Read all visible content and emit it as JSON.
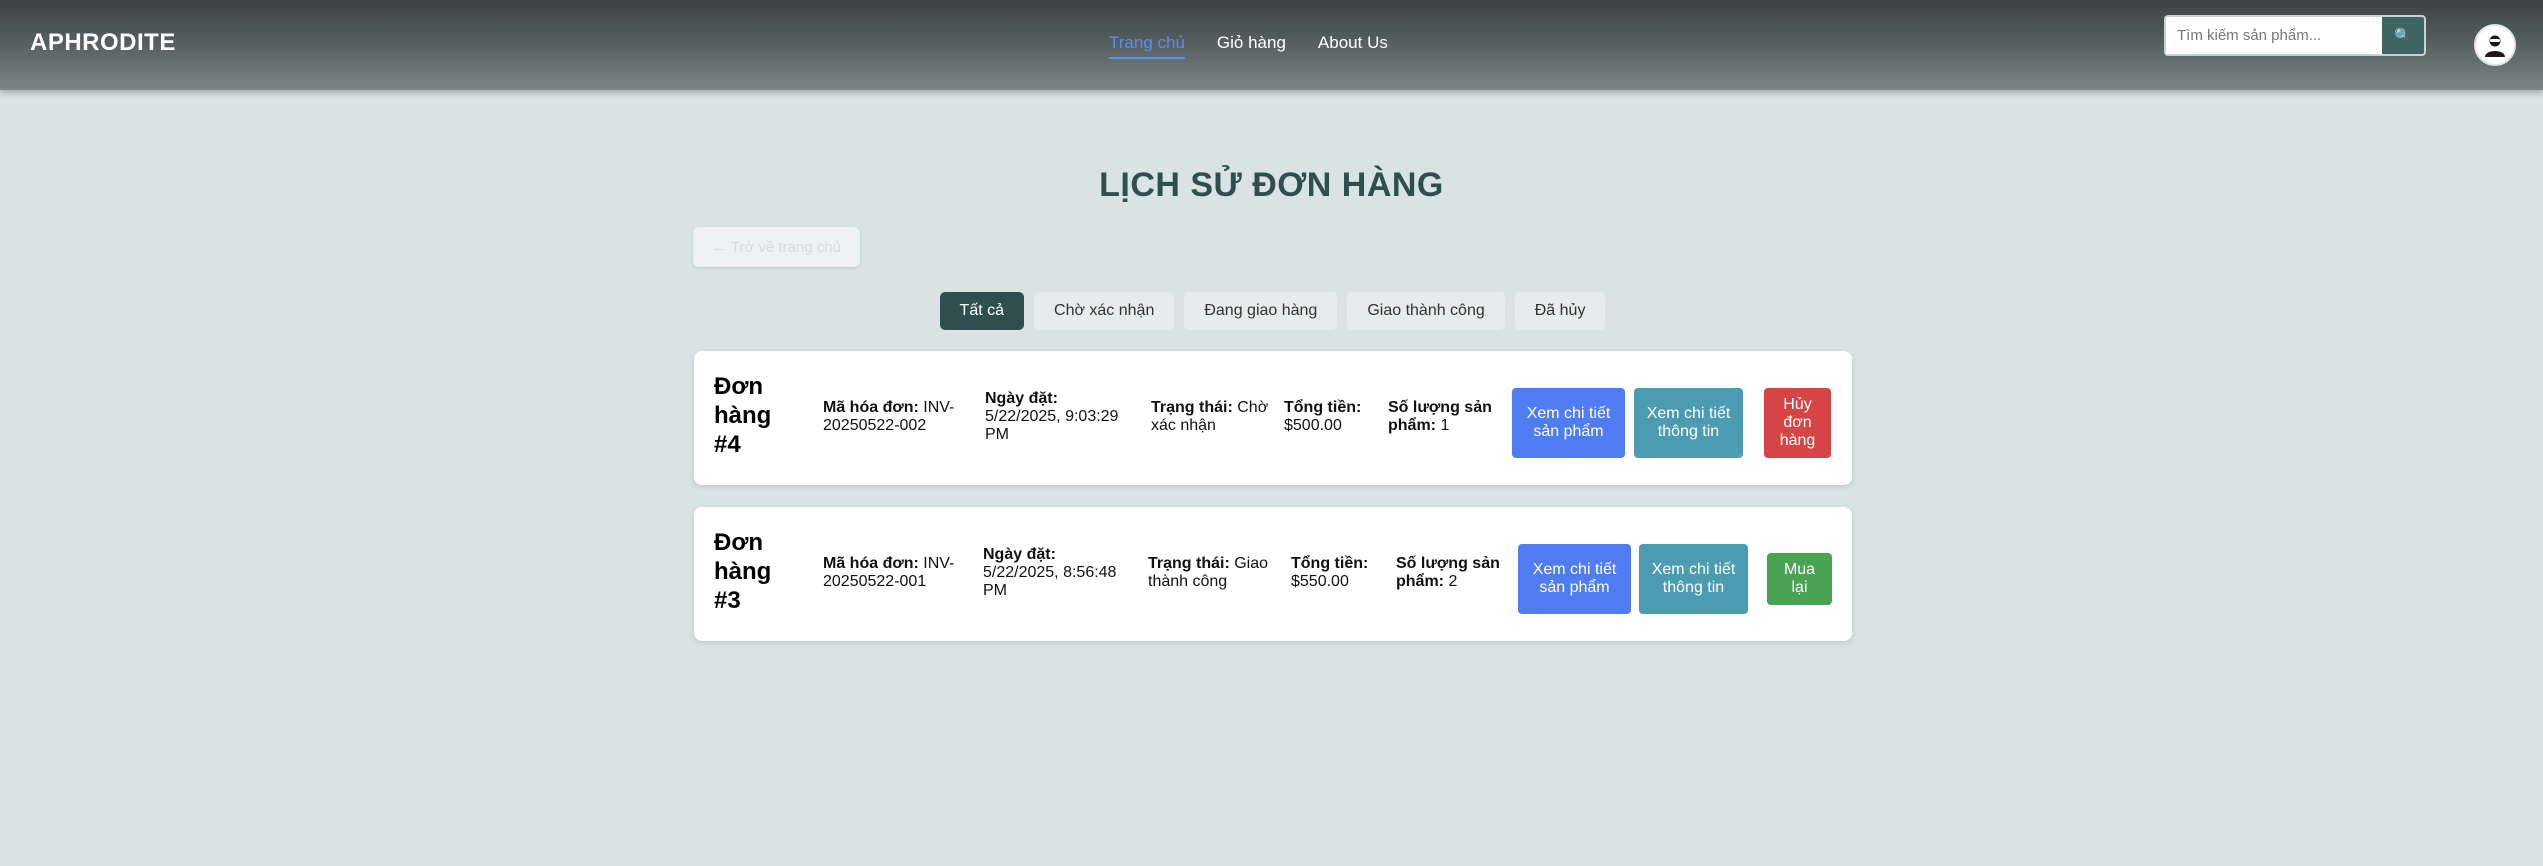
{
  "header": {
    "brand": "APHRODITE",
    "nav": [
      "Trang chủ",
      "Giỏ hàng",
      "About Us"
    ],
    "search_placeholder": "Tìm kiếm sản phẩm...",
    "search_button": "🔍"
  },
  "main": {
    "title": "LỊCH SỬ ĐƠN HÀNG",
    "back_button": "← Trở về trang chủ",
    "filters": [
      "Tất cả",
      "Chờ xác nhận",
      "Đang giao hàng",
      "Giao thành công",
      "Đã hủy"
    ],
    "labels": {
      "invoice": "Mã hóa đơn:",
      "date": "Ngày đặt:",
      "status": "Trạng thái:",
      "total": "Tổng tiền:",
      "qty": "Số lượng sản phẩm:"
    },
    "orders": [
      {
        "title": "Đơn hàng #4",
        "invoice": "INV-20250522-002",
        "date": "5/22/2025, 9:03:29 PM",
        "status": "Chờ xác nhận",
        "total": "$500.00",
        "qty": "1",
        "btn_products": "Xem chi tiết sản phẩm",
        "btn_info": "Xem chi tiết thông tin",
        "btn_action": "Hủy đơn hàng"
      },
      {
        "title": "Đơn hàng #3",
        "invoice": "INV-20250522-001",
        "date": "5/22/2025, 8:56:48 PM",
        "status": "Giao thành công",
        "total": "$550.00",
        "qty": "2",
        "btn_products": "Xem chi tiết sản phẩm",
        "btn_info": "Xem chi tiết thông tin",
        "btn_action": "Mua lại"
      }
    ]
  },
  "colors": {
    "page_bg": "#d9e3e3",
    "active_nav": "#5b8def",
    "title": "#2f4f4f",
    "blue_button": "#4f7cf0",
    "teal_button": "#4b9bb1",
    "cancel_button": "#d54545",
    "rebuy_button": "#48a353"
  }
}
